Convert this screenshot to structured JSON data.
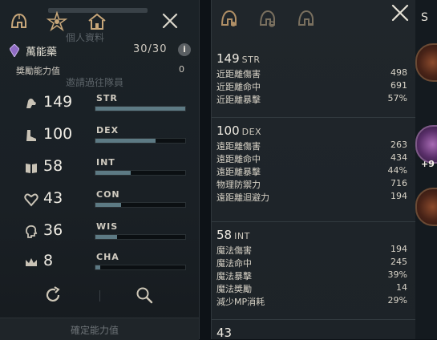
{
  "left_panel": {
    "tabs": [
      {
        "icon": "helmet-icon"
      },
      {
        "icon": "star-emblem-icon"
      },
      {
        "icon": "house-icon"
      }
    ],
    "ghost_text_1": "個人資料",
    "ghost_text_2": "邀請過往隊員",
    "potion": {
      "name": "萬能藥",
      "count": "30/30",
      "info": "i"
    },
    "bonus": {
      "label": "獎勵能力值",
      "value": "0"
    },
    "stats": [
      {
        "icon": "arm-icon",
        "value": "149",
        "label": "STR",
        "fill": 1.0
      },
      {
        "icon": "boot-icon",
        "value": "100",
        "label": "DEX",
        "fill": 0.67
      },
      {
        "icon": "book-icon",
        "value": "58",
        "label": "INT",
        "fill": 0.39
      },
      {
        "icon": "heart-icon",
        "value": "43",
        "label": "CON",
        "fill": 0.29
      },
      {
        "icon": "head-icon",
        "value": "36",
        "label": "WIS",
        "fill": 0.24
      },
      {
        "icon": "crown-icon",
        "value": "8",
        "label": "CHA",
        "fill": 0.05
      }
    ],
    "confirm_label": "確定能力值"
  },
  "right_panel": {
    "sections": [
      {
        "value": "149",
        "tag": "STR",
        "rows": [
          {
            "k": "近距離傷害",
            "v": "498"
          },
          {
            "k": "近距離命中",
            "v": "691"
          },
          {
            "k": "近距離暴擊",
            "v": "57%"
          }
        ]
      },
      {
        "value": "100",
        "tag": "DEX",
        "rows": [
          {
            "k": "遠距離傷害",
            "v": "263"
          },
          {
            "k": "遠距離命中",
            "v": "434"
          },
          {
            "k": "遠距離暴擊",
            "v": "44%"
          },
          {
            "k": "物理防禦力",
            "v": "716"
          },
          {
            "k": "遠距離迴避力",
            "v": "194"
          }
        ]
      },
      {
        "value": "58",
        "tag": "INT",
        "rows": [
          {
            "k": "魔法傷害",
            "v": "194"
          },
          {
            "k": "魔法命中",
            "v": "245"
          },
          {
            "k": "魔法暴擊",
            "v": "39%"
          },
          {
            "k": "魔法獎勵",
            "v": "14"
          },
          {
            "k": "減少MP消耗",
            "v": "29%"
          }
        ]
      },
      {
        "value": "43",
        "tag": ""
      }
    ]
  },
  "edge": {
    "letter": "S",
    "plus": "+9"
  }
}
